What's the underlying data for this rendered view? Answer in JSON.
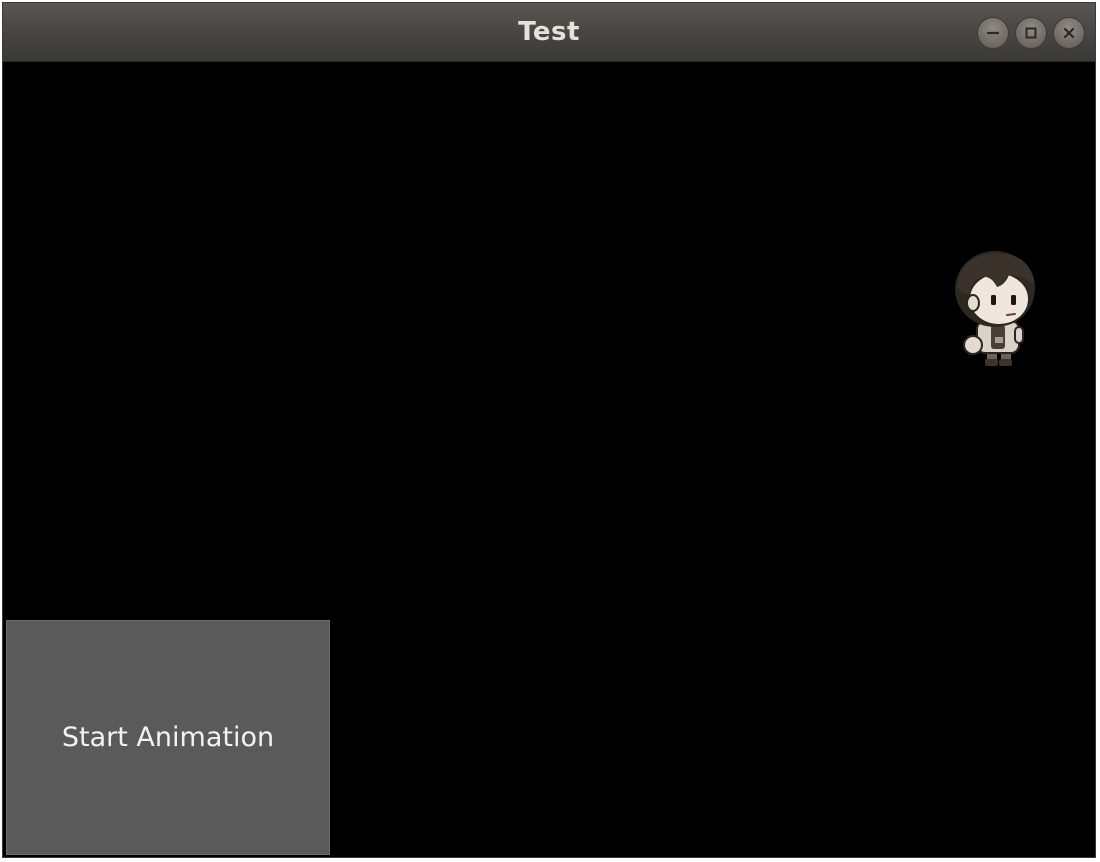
{
  "window": {
    "title": "Test",
    "controls": {
      "minimize_icon": "minimize-icon",
      "maximize_icon": "maximize-icon",
      "close_icon": "close-icon"
    }
  },
  "canvas": {
    "background": "#000000",
    "sprite_icon": "character-sprite-icon"
  },
  "start_button": {
    "label": "Start Animation",
    "background": "#5a5a5a"
  }
}
